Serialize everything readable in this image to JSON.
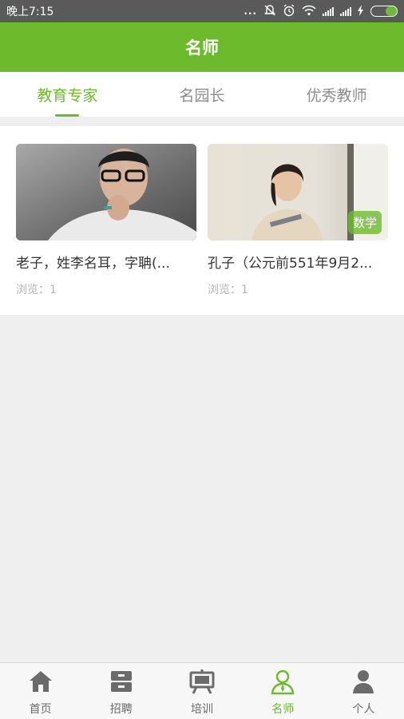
{
  "status_bar": {
    "time": "晚上7:15",
    "dots": "..."
  },
  "header": {
    "title": "名师"
  },
  "tabs": [
    {
      "label": "教育专家",
      "active": true
    },
    {
      "label": "名园长",
      "active": false
    },
    {
      "label": "优秀教师",
      "active": false
    }
  ],
  "cards": [
    {
      "title": "老子，姓李名耳，字聃(...",
      "views": "浏览：1",
      "tag": ""
    },
    {
      "title": "孔子（公元前551年9月2...",
      "views": "浏览：1",
      "tag": "数学"
    }
  ],
  "bottom_nav": [
    {
      "label": "首页",
      "icon": "home-icon",
      "active": false
    },
    {
      "label": "招聘",
      "icon": "cabinet-icon",
      "active": false
    },
    {
      "label": "培训",
      "icon": "easel-icon",
      "active": false
    },
    {
      "label": "名师",
      "icon": "teacher-icon",
      "active": true
    },
    {
      "label": "个人",
      "icon": "person-icon",
      "active": false
    }
  ],
  "colors": {
    "accent": "#6dbb2d",
    "status_bar": "#5a5a5a",
    "background": "#efefef"
  }
}
